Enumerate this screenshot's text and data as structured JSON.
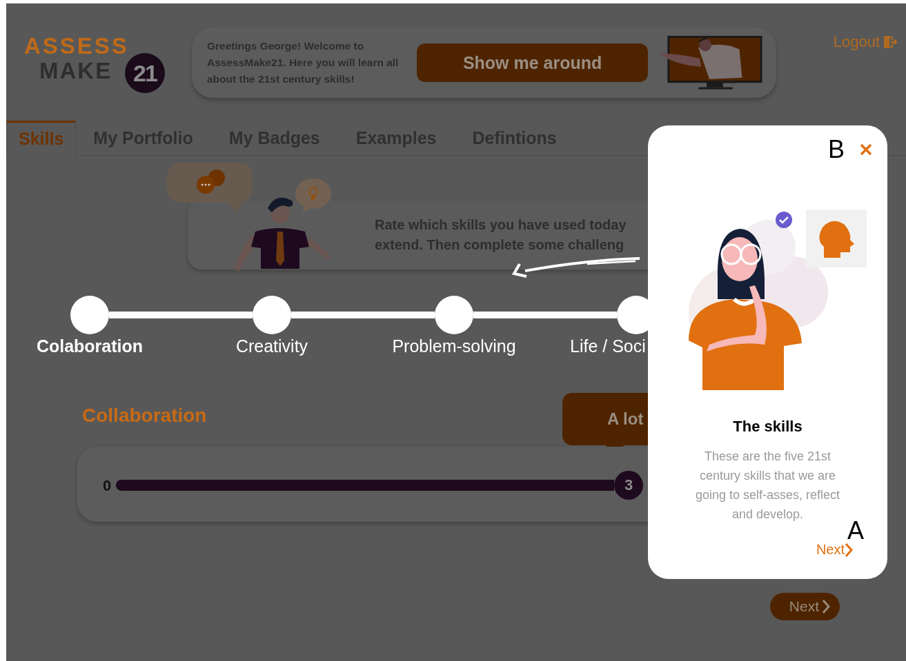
{
  "logo": {
    "top": "ASSESS",
    "bottom": "MAKE",
    "badge": "21"
  },
  "greeting": {
    "text": "Greetings George! Welcome to AssessMake21. Here you will learn all about the 21st century skills!",
    "button": "Show me around"
  },
  "logout": "Logout",
  "tabs": [
    {
      "label": "Skills",
      "selected": true
    },
    {
      "label": "My Portfolio",
      "selected": false
    },
    {
      "label": "My Badges",
      "selected": false
    },
    {
      "label": "Examples",
      "selected": false
    },
    {
      "label": "Defintions",
      "selected": false
    }
  ],
  "instructions": {
    "lines": [
      "Rate which skills you have used today",
      "extend. Then complete some challeng"
    ]
  },
  "steps": [
    {
      "label": "Colaboration",
      "selected": true
    },
    {
      "label": "Creativity",
      "selected": false
    },
    {
      "label": "Problem-solving",
      "selected": false
    },
    {
      "label": "Life / Soci",
      "selected": false
    }
  ],
  "rating": {
    "heading": "Collaboration",
    "tooltip": "A lot",
    "min": "0",
    "value": "3"
  },
  "next_button": "Next",
  "popup": {
    "title": "The skills",
    "body": "These are the five 21st century skills that we are going to self-asses, reflect and develop.",
    "next": "Next",
    "markers": [
      "B",
      "A"
    ]
  }
}
